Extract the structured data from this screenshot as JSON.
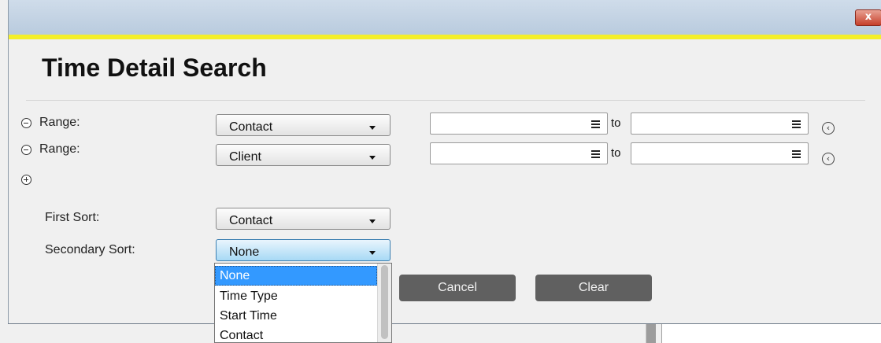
{
  "dialog": {
    "title": "Time Detail Search",
    "close_glyph": "x"
  },
  "ranges": [
    {
      "label": "Range:",
      "field": "Contact",
      "to_label": "to"
    },
    {
      "label": "Range:",
      "field": "Client",
      "to_label": "to"
    }
  ],
  "sort": {
    "first_label": "First Sort:",
    "first_value": "Contact",
    "secondary_label": "Secondary Sort:",
    "secondary_value": "None"
  },
  "dropdown_options": [
    "None",
    "Time Type",
    "Start Time",
    "Contact"
  ],
  "buttons": {
    "cancel": "Cancel",
    "clear": "Clear"
  },
  "icons": {
    "remove": "minus-circle-icon",
    "add": "plus-circle-icon",
    "field_menu": "hamburger-icon",
    "collapse": "chevron-left-circle-icon"
  },
  "colors": {
    "accent_line": "#f4ef2a",
    "selection": "#3399ff",
    "button_dark": "#606060"
  }
}
